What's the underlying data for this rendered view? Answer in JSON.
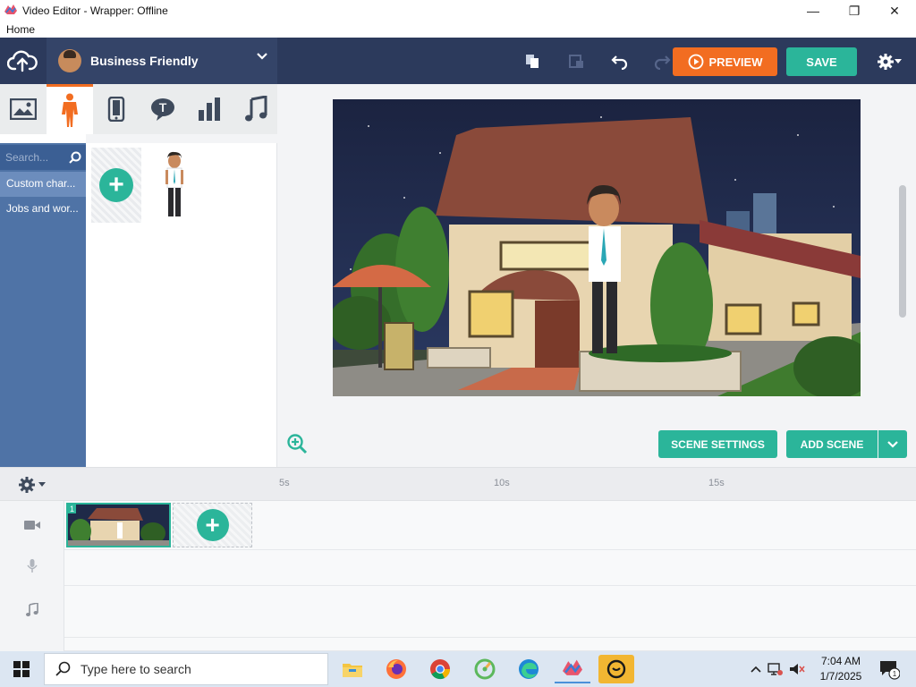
{
  "window": {
    "title": "Video Editor - Wrapper: Offline",
    "menu_home": "Home",
    "minimize": "—",
    "maximize": "❐",
    "close": "✕"
  },
  "toolbar": {
    "theme_name": "Business Friendly",
    "preview_label": "PREVIEW",
    "save_label": "SAVE"
  },
  "library": {
    "search_placeholder": "Search...",
    "categories": [
      "Custom char...",
      "Jobs and wor..."
    ]
  },
  "stage": {
    "scene_settings_label": "SCENE SETTINGS",
    "add_scene_label": "ADD SCENE"
  },
  "timeline": {
    "ticks": [
      "5s",
      "10s",
      "15s"
    ],
    "scene_number": "1"
  },
  "taskbar": {
    "search_text": "Type here to search",
    "time": "7:04 AM",
    "date": "1/7/2025",
    "notification_count": "1"
  },
  "colors": {
    "accent_teal": "#2bb59a",
    "accent_orange": "#f26d21",
    "toolbar_navy": "#2c3a5c",
    "sidebar_blue": "#4f73a6"
  }
}
